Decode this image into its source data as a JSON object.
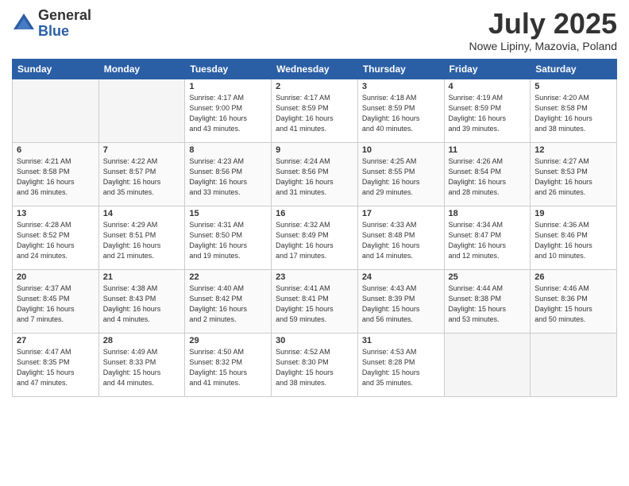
{
  "logo": {
    "general": "General",
    "blue": "Blue"
  },
  "title": "July 2025",
  "location": "Nowe Lipiny, Mazovia, Poland",
  "headers": [
    "Sunday",
    "Monday",
    "Tuesday",
    "Wednesday",
    "Thursday",
    "Friday",
    "Saturday"
  ],
  "weeks": [
    [
      {
        "day": "",
        "info": ""
      },
      {
        "day": "",
        "info": ""
      },
      {
        "day": "1",
        "info": "Sunrise: 4:17 AM\nSunset: 9:00 PM\nDaylight: 16 hours\nand 43 minutes."
      },
      {
        "day": "2",
        "info": "Sunrise: 4:17 AM\nSunset: 8:59 PM\nDaylight: 16 hours\nand 41 minutes."
      },
      {
        "day": "3",
        "info": "Sunrise: 4:18 AM\nSunset: 8:59 PM\nDaylight: 16 hours\nand 40 minutes."
      },
      {
        "day": "4",
        "info": "Sunrise: 4:19 AM\nSunset: 8:59 PM\nDaylight: 16 hours\nand 39 minutes."
      },
      {
        "day": "5",
        "info": "Sunrise: 4:20 AM\nSunset: 8:58 PM\nDaylight: 16 hours\nand 38 minutes."
      }
    ],
    [
      {
        "day": "6",
        "info": "Sunrise: 4:21 AM\nSunset: 8:58 PM\nDaylight: 16 hours\nand 36 minutes."
      },
      {
        "day": "7",
        "info": "Sunrise: 4:22 AM\nSunset: 8:57 PM\nDaylight: 16 hours\nand 35 minutes."
      },
      {
        "day": "8",
        "info": "Sunrise: 4:23 AM\nSunset: 8:56 PM\nDaylight: 16 hours\nand 33 minutes."
      },
      {
        "day": "9",
        "info": "Sunrise: 4:24 AM\nSunset: 8:56 PM\nDaylight: 16 hours\nand 31 minutes."
      },
      {
        "day": "10",
        "info": "Sunrise: 4:25 AM\nSunset: 8:55 PM\nDaylight: 16 hours\nand 29 minutes."
      },
      {
        "day": "11",
        "info": "Sunrise: 4:26 AM\nSunset: 8:54 PM\nDaylight: 16 hours\nand 28 minutes."
      },
      {
        "day": "12",
        "info": "Sunrise: 4:27 AM\nSunset: 8:53 PM\nDaylight: 16 hours\nand 26 minutes."
      }
    ],
    [
      {
        "day": "13",
        "info": "Sunrise: 4:28 AM\nSunset: 8:52 PM\nDaylight: 16 hours\nand 24 minutes."
      },
      {
        "day": "14",
        "info": "Sunrise: 4:29 AM\nSunset: 8:51 PM\nDaylight: 16 hours\nand 21 minutes."
      },
      {
        "day": "15",
        "info": "Sunrise: 4:31 AM\nSunset: 8:50 PM\nDaylight: 16 hours\nand 19 minutes."
      },
      {
        "day": "16",
        "info": "Sunrise: 4:32 AM\nSunset: 8:49 PM\nDaylight: 16 hours\nand 17 minutes."
      },
      {
        "day": "17",
        "info": "Sunrise: 4:33 AM\nSunset: 8:48 PM\nDaylight: 16 hours\nand 14 minutes."
      },
      {
        "day": "18",
        "info": "Sunrise: 4:34 AM\nSunset: 8:47 PM\nDaylight: 16 hours\nand 12 minutes."
      },
      {
        "day": "19",
        "info": "Sunrise: 4:36 AM\nSunset: 8:46 PM\nDaylight: 16 hours\nand 10 minutes."
      }
    ],
    [
      {
        "day": "20",
        "info": "Sunrise: 4:37 AM\nSunset: 8:45 PM\nDaylight: 16 hours\nand 7 minutes."
      },
      {
        "day": "21",
        "info": "Sunrise: 4:38 AM\nSunset: 8:43 PM\nDaylight: 16 hours\nand 4 minutes."
      },
      {
        "day": "22",
        "info": "Sunrise: 4:40 AM\nSunset: 8:42 PM\nDaylight: 16 hours\nand 2 minutes."
      },
      {
        "day": "23",
        "info": "Sunrise: 4:41 AM\nSunset: 8:41 PM\nDaylight: 15 hours\nand 59 minutes."
      },
      {
        "day": "24",
        "info": "Sunrise: 4:43 AM\nSunset: 8:39 PM\nDaylight: 15 hours\nand 56 minutes."
      },
      {
        "day": "25",
        "info": "Sunrise: 4:44 AM\nSunset: 8:38 PM\nDaylight: 15 hours\nand 53 minutes."
      },
      {
        "day": "26",
        "info": "Sunrise: 4:46 AM\nSunset: 8:36 PM\nDaylight: 15 hours\nand 50 minutes."
      }
    ],
    [
      {
        "day": "27",
        "info": "Sunrise: 4:47 AM\nSunset: 8:35 PM\nDaylight: 15 hours\nand 47 minutes."
      },
      {
        "day": "28",
        "info": "Sunrise: 4:49 AM\nSunset: 8:33 PM\nDaylight: 15 hours\nand 44 minutes."
      },
      {
        "day": "29",
        "info": "Sunrise: 4:50 AM\nSunset: 8:32 PM\nDaylight: 15 hours\nand 41 minutes."
      },
      {
        "day": "30",
        "info": "Sunrise: 4:52 AM\nSunset: 8:30 PM\nDaylight: 15 hours\nand 38 minutes."
      },
      {
        "day": "31",
        "info": "Sunrise: 4:53 AM\nSunset: 8:28 PM\nDaylight: 15 hours\nand 35 minutes."
      },
      {
        "day": "",
        "info": ""
      },
      {
        "day": "",
        "info": ""
      }
    ]
  ]
}
